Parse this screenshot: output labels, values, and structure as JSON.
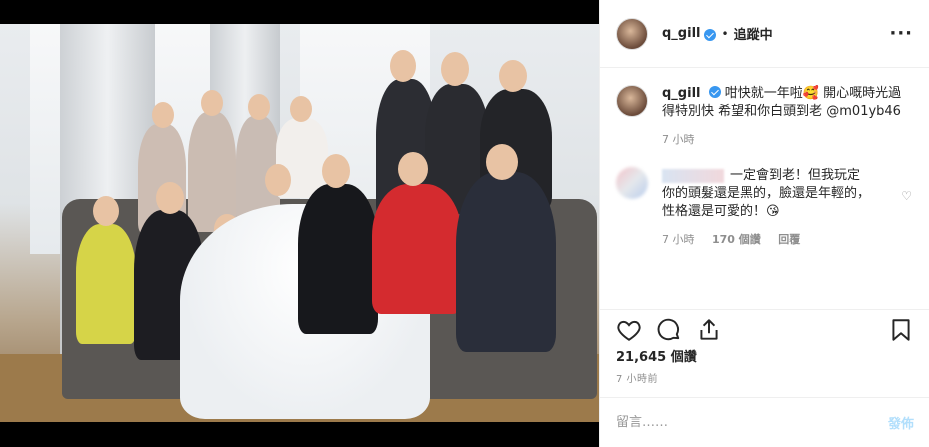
{
  "post": {
    "username": "q_gill",
    "follow_status": "追蹤中",
    "caption": "咁快就一年啦🥰 開心嘅時光過得特別快 希望和你白頭到老 @m01yb46",
    "caption_time": "7 小時",
    "likes": "21,645 個讚",
    "posted_time": "7 小時前"
  },
  "comment": {
    "text": "一定會到老！但我玩定你的頭髮還是黑的，臉還是年輕的，性格還是可愛的！😘",
    "time": "7 小時",
    "likes": "170 個讚",
    "reply": "回覆"
  },
  "composer": {
    "placeholder": "留言……",
    "post_label": "發佈"
  },
  "icons": {
    "like": "heart-icon",
    "comment": "comment-icon",
    "share": "share-icon",
    "save": "bookmark-icon",
    "more": "more-options-icon",
    "verified": "verified-badge-icon"
  },
  "colors": {
    "verified": "#3897f0",
    "post_button": "#b2dffc",
    "muted": "#8e8e8e"
  }
}
